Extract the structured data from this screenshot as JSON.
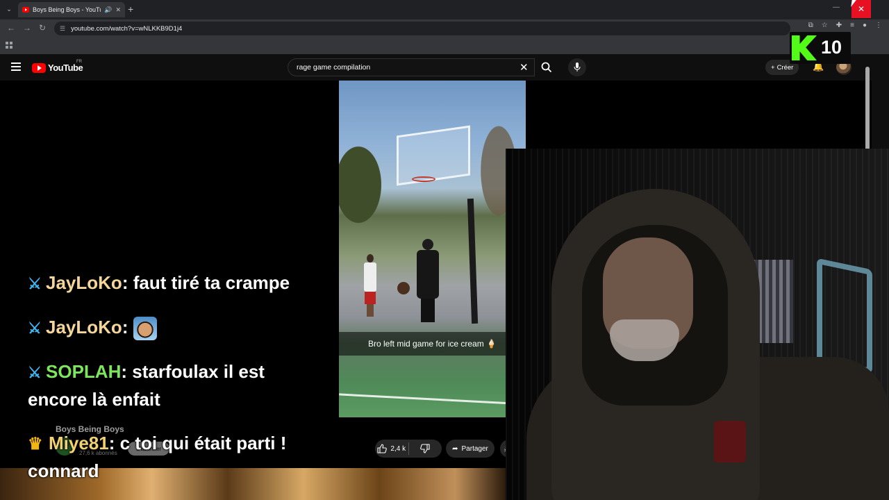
{
  "browser": {
    "tab_title": "Boys Being Boys - YouTube",
    "new_tab": "+",
    "url": "youtube.com/watch?v=wNLKKB9D1j4"
  },
  "youtube": {
    "logo_text": "YouTube",
    "country": "FR",
    "search_value": "rage game compilation",
    "create_label": "Créer",
    "video_caption": "Bro left mid game for ice cream 🍦",
    "channel_name": "Boys Being Boys",
    "subscribers": "27,6 k abonnés",
    "subscribe_label": "S'abonner",
    "likes": "2,4 k",
    "share_label": "Partager",
    "download_label": "Té"
  },
  "chat": [
    {
      "badge": "sword",
      "user": "JayLoKo",
      "user_color": "#f4d69a",
      "text": "faut tiré ta crampe"
    },
    {
      "badge": "sword",
      "user": "JayLoKo",
      "user_color": "#f4d69a",
      "text": "",
      "emote": "laughing-face-emote"
    },
    {
      "badge": "sword",
      "user": "SOPLAH",
      "user_color": "#7ee65c",
      "text": "starfoulax il est encore là enfait"
    },
    {
      "badge": "crown",
      "user": "Miye81",
      "user_color": "#f2d171",
      "text": "c toi qui était parti ! connard"
    }
  ],
  "kick_badge": {
    "count": "10",
    "color": "#53fc18"
  }
}
